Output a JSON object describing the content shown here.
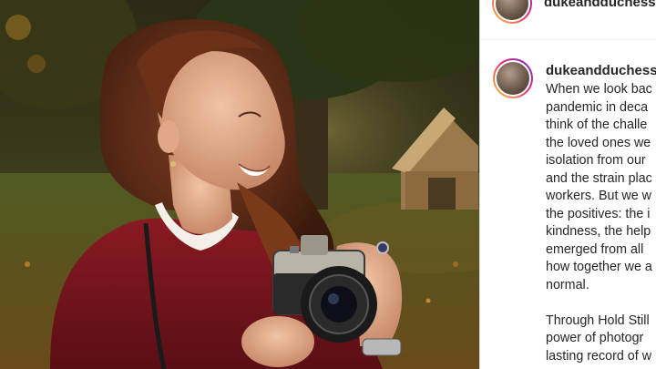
{
  "post": {
    "header_username": "dukeandduchesso",
    "caption_username": "dukeandduchesso",
    "caption_lines": [
      "When we look bac",
      "pandemic in deca",
      "think of the challe",
      "the loved ones we",
      "isolation from our",
      "and the strain plac",
      "workers. But we w",
      "the positives: the i",
      "kindness, the help",
      "emerged from all",
      "how together we a",
      "normal.",
      "",
      "Through Hold Still",
      "power of photogr",
      "lasting record of w"
    ]
  },
  "photo": {
    "description_icon": "photo-woman-with-camera"
  },
  "colors": {
    "text": "#262626",
    "border": "#dbdbdb",
    "story_ring_start": "#f9ce34",
    "story_ring_end": "#6228d7"
  }
}
